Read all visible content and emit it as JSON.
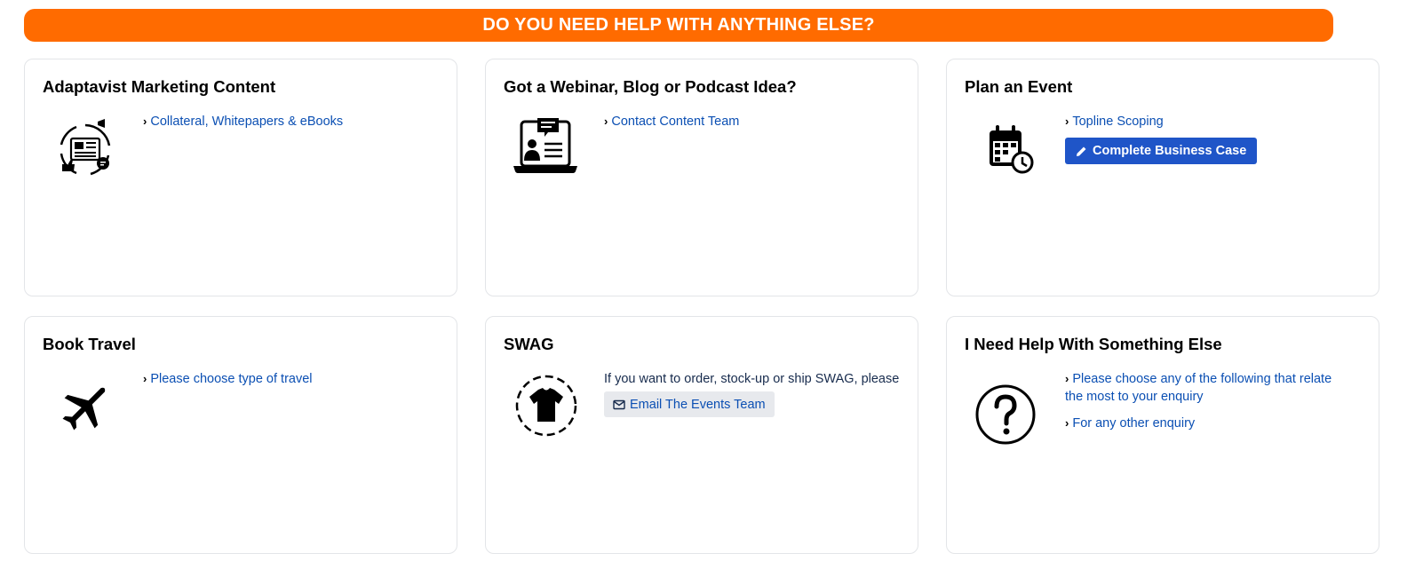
{
  "banner": {
    "text": "DO YOU NEED HELP WITH ANYTHING ELSE?"
  },
  "cards": {
    "marketing": {
      "title": "Adaptavist Marketing Content",
      "icon": "news-cycle-icon",
      "links": [
        "Collateral, Whitepapers & eBooks"
      ]
    },
    "webinar": {
      "title": "Got a Webinar, Blog or Podcast Idea?",
      "icon": "laptop-presenter-icon",
      "links": [
        "Contact Content Team"
      ]
    },
    "event": {
      "title": "Plan an Event",
      "icon": "calendar-clock-icon",
      "links": [
        "Topline Scoping"
      ],
      "button": "Complete Business Case"
    },
    "travel": {
      "title": "Book Travel",
      "icon": "airplane-icon",
      "links": [
        "Please choose type of travel"
      ]
    },
    "swag": {
      "title": "SWAG",
      "icon": "tshirt-icon",
      "text": "If you want to order, stock-up or ship SWAG, please",
      "button": "Email The Events Team"
    },
    "other": {
      "title": "I Need Help With Something Else",
      "icon": "question-circle-icon",
      "links": [
        "Please choose any of the following that relate the most to your enquiry",
        "For any other enquiry"
      ]
    }
  },
  "colors": {
    "banner": "#ff6b00",
    "link": "#0b4fb3",
    "primary_button": "#1f55c8"
  }
}
